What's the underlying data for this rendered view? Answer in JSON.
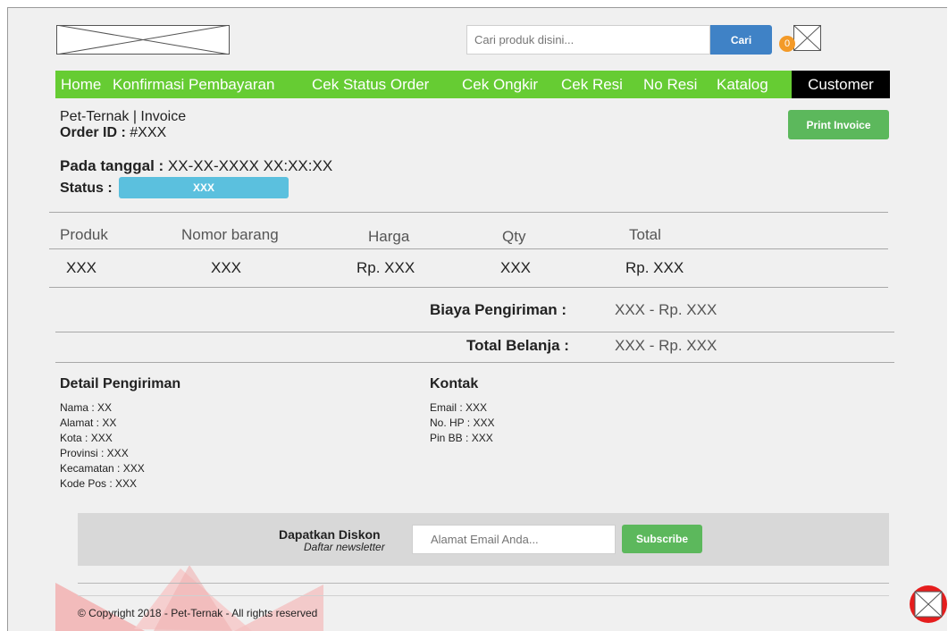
{
  "header": {
    "search": {
      "placeholder": "Cari produk disini...",
      "button_label": "Cari"
    },
    "cart_count": "0"
  },
  "nav": {
    "items": [
      "Home",
      "Konfirmasi Pembayaran",
      "Cek Status Order",
      "Cek Ongkir",
      "Cek Resi",
      "No Resi",
      "Katalog"
    ],
    "customer": "Customer"
  },
  "invoice": {
    "breadcrumb": "Pet-Ternak | Invoice",
    "order_label": "Order ID :",
    "order_value": "#XXX",
    "print_button": "Print Invoice",
    "date_label": "Pada tanggal :",
    "date_value": "XX-XX-XXXX XX:XX:XX",
    "status_label": "Status :",
    "status_value": "XXX"
  },
  "table": {
    "headers": [
      "Produk",
      "Nomor barang",
      "Harga",
      "Qty",
      "Total"
    ],
    "rows": [
      [
        "XXX",
        "XXX",
        "Rp. XXX",
        "XXX",
        "Rp. XXX"
      ]
    ]
  },
  "summary": {
    "shipping_label": "Biaya Pengiriman :",
    "shipping_value": "XXX - Rp. XXX",
    "total_label": "Total Belanja :",
    "total_value": "XXX - Rp. XXX"
  },
  "shipping": {
    "title": "Detail Pengiriman",
    "lines": [
      "Nama : XX",
      "Alamat : XX",
      "Kota : XXX",
      "Provinsi : XXX",
      "Kecamatan : XXX",
      "Kode Pos : XXX"
    ]
  },
  "contact": {
    "title": "Kontak",
    "lines": [
      "Email : XXX",
      "No. HP : XXX",
      "Pin BB : XXX"
    ]
  },
  "newsletter": {
    "title": "Dapatkan Diskon",
    "subtitle": "Daftar newsletter",
    "placeholder": "Alamat Email Anda...",
    "button": "Subscribe"
  },
  "footer": {
    "copyright": "© Copyright 2018 - Pet-Ternak - All rights reserved"
  },
  "colors": {
    "nav_green": "#66cc33",
    "search_blue": "#3f82c6",
    "button_green": "#5cb85c",
    "status_blue": "#5bc0de",
    "badge_orange": "#f39a28"
  }
}
